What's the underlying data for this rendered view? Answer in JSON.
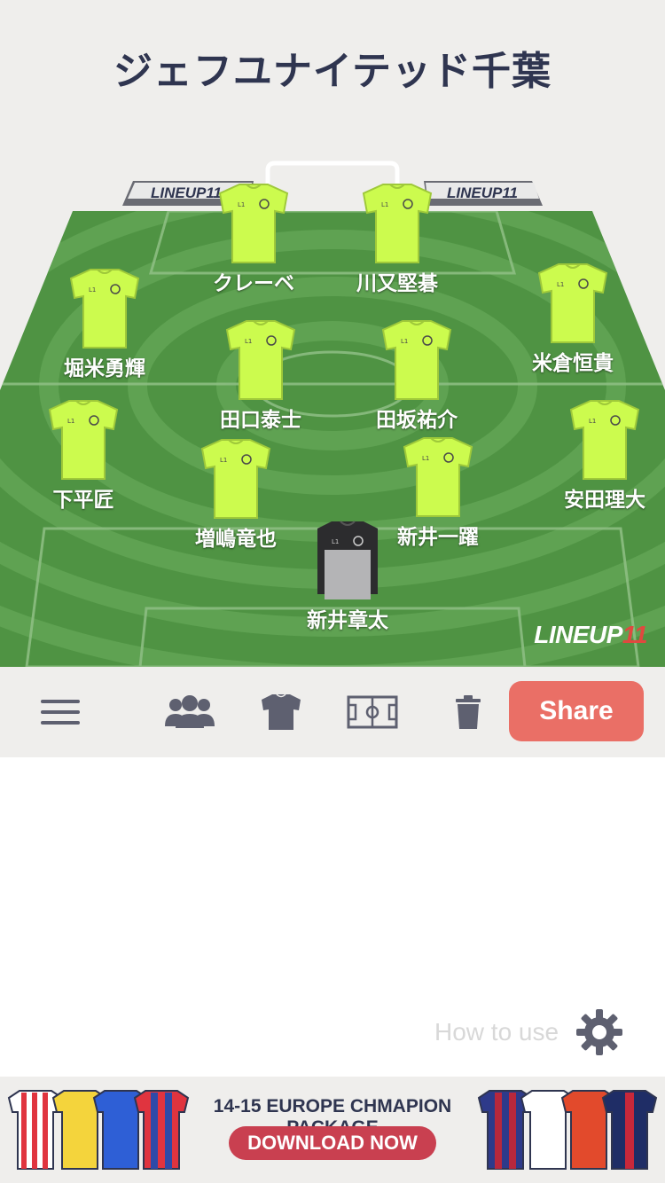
{
  "team": {
    "name": "ジェフユナイテッド千葉"
  },
  "boards": {
    "left": "LINEUP11",
    "right": "LINEUP11"
  },
  "watermark": {
    "text": "LINEUP",
    "number": "11"
  },
  "players": [
    {
      "name": "クレーベ",
      "kit": "outfield"
    },
    {
      "name": "川又堅碁",
      "kit": "outfield"
    },
    {
      "name": "堀米勇輝",
      "kit": "outfield"
    },
    {
      "name": "米倉恒貴",
      "kit": "outfield"
    },
    {
      "name": "田口泰士",
      "kit": "outfield"
    },
    {
      "name": "田坂祐介",
      "kit": "outfield"
    },
    {
      "name": "下平匠",
      "kit": "outfield"
    },
    {
      "name": "安田理大",
      "kit": "outfield"
    },
    {
      "name": "増嶋竜也",
      "kit": "outfield"
    },
    {
      "name": "新井一躍",
      "kit": "outfield"
    },
    {
      "name": "新井章太",
      "kit": "goalkeeper"
    }
  ],
  "toolbar": {
    "menu_icon": "hamburger-menu-icon",
    "team_icon": "players-group-icon",
    "kit_icon": "shirt-icon",
    "pitch_icon": "pitch-icon",
    "delete_icon": "trash-icon",
    "share_label": "Share"
  },
  "help": {
    "label": "How to use",
    "icon": "gear-icon"
  },
  "ad": {
    "title": "14-15 EUROPE CHMAPION PACKAGE",
    "button": "DOWNLOAD NOW"
  },
  "colors": {
    "background": "#efeeec",
    "title": "#2f3550",
    "pitch_dark": "#4a8c3f",
    "pitch_light": "#63a356",
    "kit": "#ccfb4e",
    "share": "#ea6f66",
    "icon": "#5e6070"
  }
}
